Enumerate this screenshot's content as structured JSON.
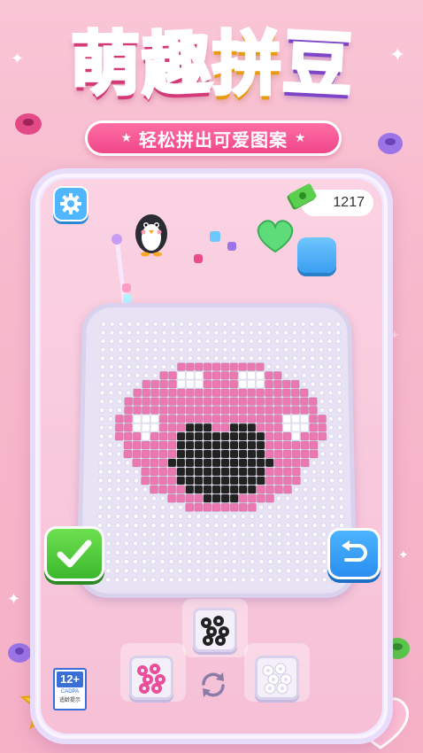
{
  "title": {
    "chars": [
      "萌",
      "趣",
      "拼",
      "豆"
    ]
  },
  "subtitle": "轻松拼出可爱图案",
  "hud": {
    "coins": "1217"
  },
  "age_rating": {
    "age": "12+",
    "org": "CADPA",
    "hint": "适龄提示"
  },
  "colors": {
    "pink_bead": "#ec78b2",
    "white_bead": "#ffffff",
    "black_bead": "#222222",
    "empty_peg": "#ffffff",
    "accent_green": "#3cb82e",
    "accent_blue": "#2a8ef0"
  },
  "icons": {
    "settings": "gear-icon",
    "confirm": "check-icon",
    "undo": "undo-icon",
    "refresh": "refresh-icon",
    "currency": "money-icon"
  }
}
